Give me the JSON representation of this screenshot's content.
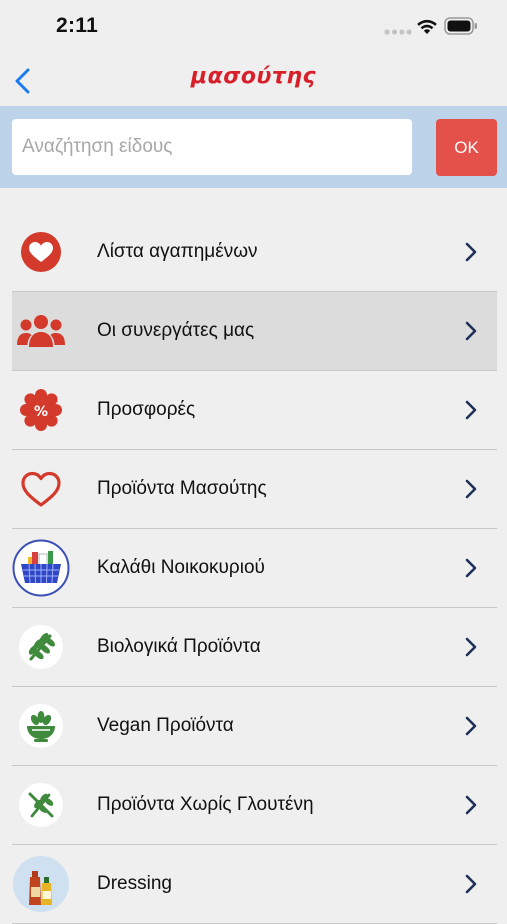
{
  "status_bar": {
    "time": "2:11"
  },
  "header": {
    "logo_text": "μασούτης",
    "brand_color": "#d8202a"
  },
  "search": {
    "placeholder": "Αναζήτηση είδους",
    "value": "",
    "ok_label": "OK",
    "button_color": "#e4514a",
    "band_color": "#bcd3ea"
  },
  "menu": {
    "items": [
      {
        "label": "Λίστα αγαπημένων",
        "icon": "heart-circle-icon"
      },
      {
        "label": "Οι συνεργάτες μας",
        "icon": "partners-icon",
        "selected": true
      },
      {
        "label": "Προσφορές",
        "icon": "discount-badge-icon"
      },
      {
        "label": "Προϊόντα Μασούτης",
        "icon": "heart-outline-icon"
      },
      {
        "label": "Καλάθι Νοικοκυριού",
        "icon": "shopping-basket-icon"
      },
      {
        "label": "Βιολογικά Προϊόντα",
        "icon": "organic-leaf-icon"
      },
      {
        "label": "Vegan Προϊόντα",
        "icon": "vegan-bowl-icon"
      },
      {
        "label": "Προϊόντα Χωρίς Γλουτένη",
        "icon": "gluten-free-icon"
      },
      {
        "label": "Dressing",
        "icon": "dressing-bottles-icon"
      }
    ]
  }
}
